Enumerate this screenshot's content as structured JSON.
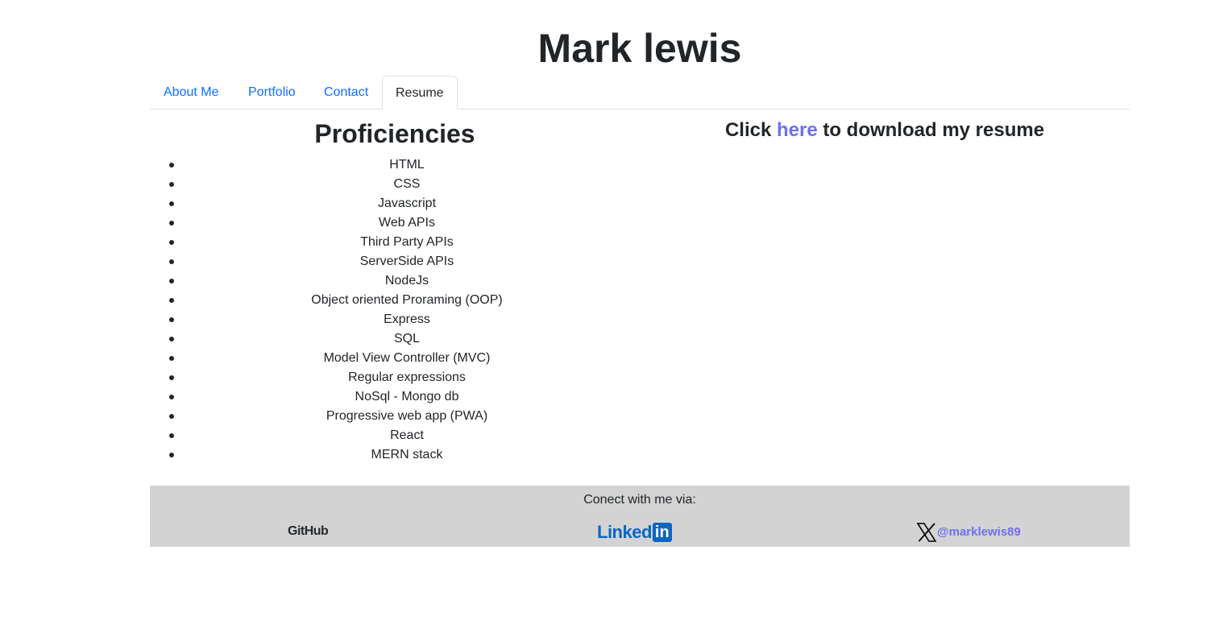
{
  "header": {
    "title": "Mark lewis"
  },
  "nav": {
    "tabs": [
      {
        "label": "About Me",
        "active": false
      },
      {
        "label": "Portfolio",
        "active": false
      },
      {
        "label": "Contact",
        "active": false
      },
      {
        "label": "Resume",
        "active": true
      }
    ]
  },
  "proficiencies": {
    "title": "Proficiencies",
    "items": [
      "HTML",
      "CSS",
      "Javascript",
      "Web APIs",
      "Third Party APIs",
      "ServerSide APIs",
      "NodeJs",
      "Object oriented Proraming (OOP)",
      "Express",
      "SQL",
      "Model View Controller (MVC)",
      "Regular expressions",
      "NoSql - Mongo db",
      "Progressive web app (PWA)",
      "React",
      "MERN stack"
    ]
  },
  "resume": {
    "prefix": "Click ",
    "link_label": "here",
    "suffix": " to download my resume"
  },
  "footer": {
    "text": "Conect with me via:",
    "github_label": "GitHub",
    "linkedin_label": "Linked",
    "linkedin_box": "in",
    "x_icon": "x-logo-icon",
    "x_handle": "@marklewis89"
  },
  "colors": {
    "link": "#0d6efd",
    "resume_link": "#6f6ff0",
    "footer_bg": "#d3d3d3",
    "linkedin": "#0a66c2"
  }
}
